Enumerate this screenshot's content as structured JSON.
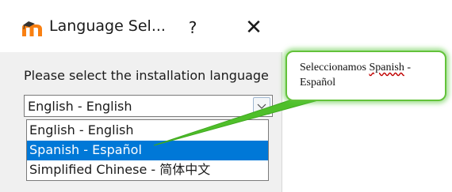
{
  "dialog": {
    "title": "Language Sel...",
    "help_label": "?",
    "close_label": "✕",
    "prompt": "Please select the installation language",
    "combo_value": "English - English",
    "options": [
      {
        "label": "English - English",
        "selected": false
      },
      {
        "label": "Spanish - Español",
        "selected": true
      },
      {
        "label": "Simplified Chinese - 简体中文",
        "selected": false
      }
    ]
  },
  "callout": {
    "text_before": "Seleccionamos ",
    "link_text": "Spanish",
    "text_after": " - Español"
  },
  "colors": {
    "selection": "#0078d7",
    "callout_border": "#63c23a",
    "pointer": "#4fbf2a",
    "moodle_orange": "#f98012"
  },
  "icons": {
    "app": "moodle-logo-icon",
    "combo_arrow": "chevron-down-icon"
  }
}
